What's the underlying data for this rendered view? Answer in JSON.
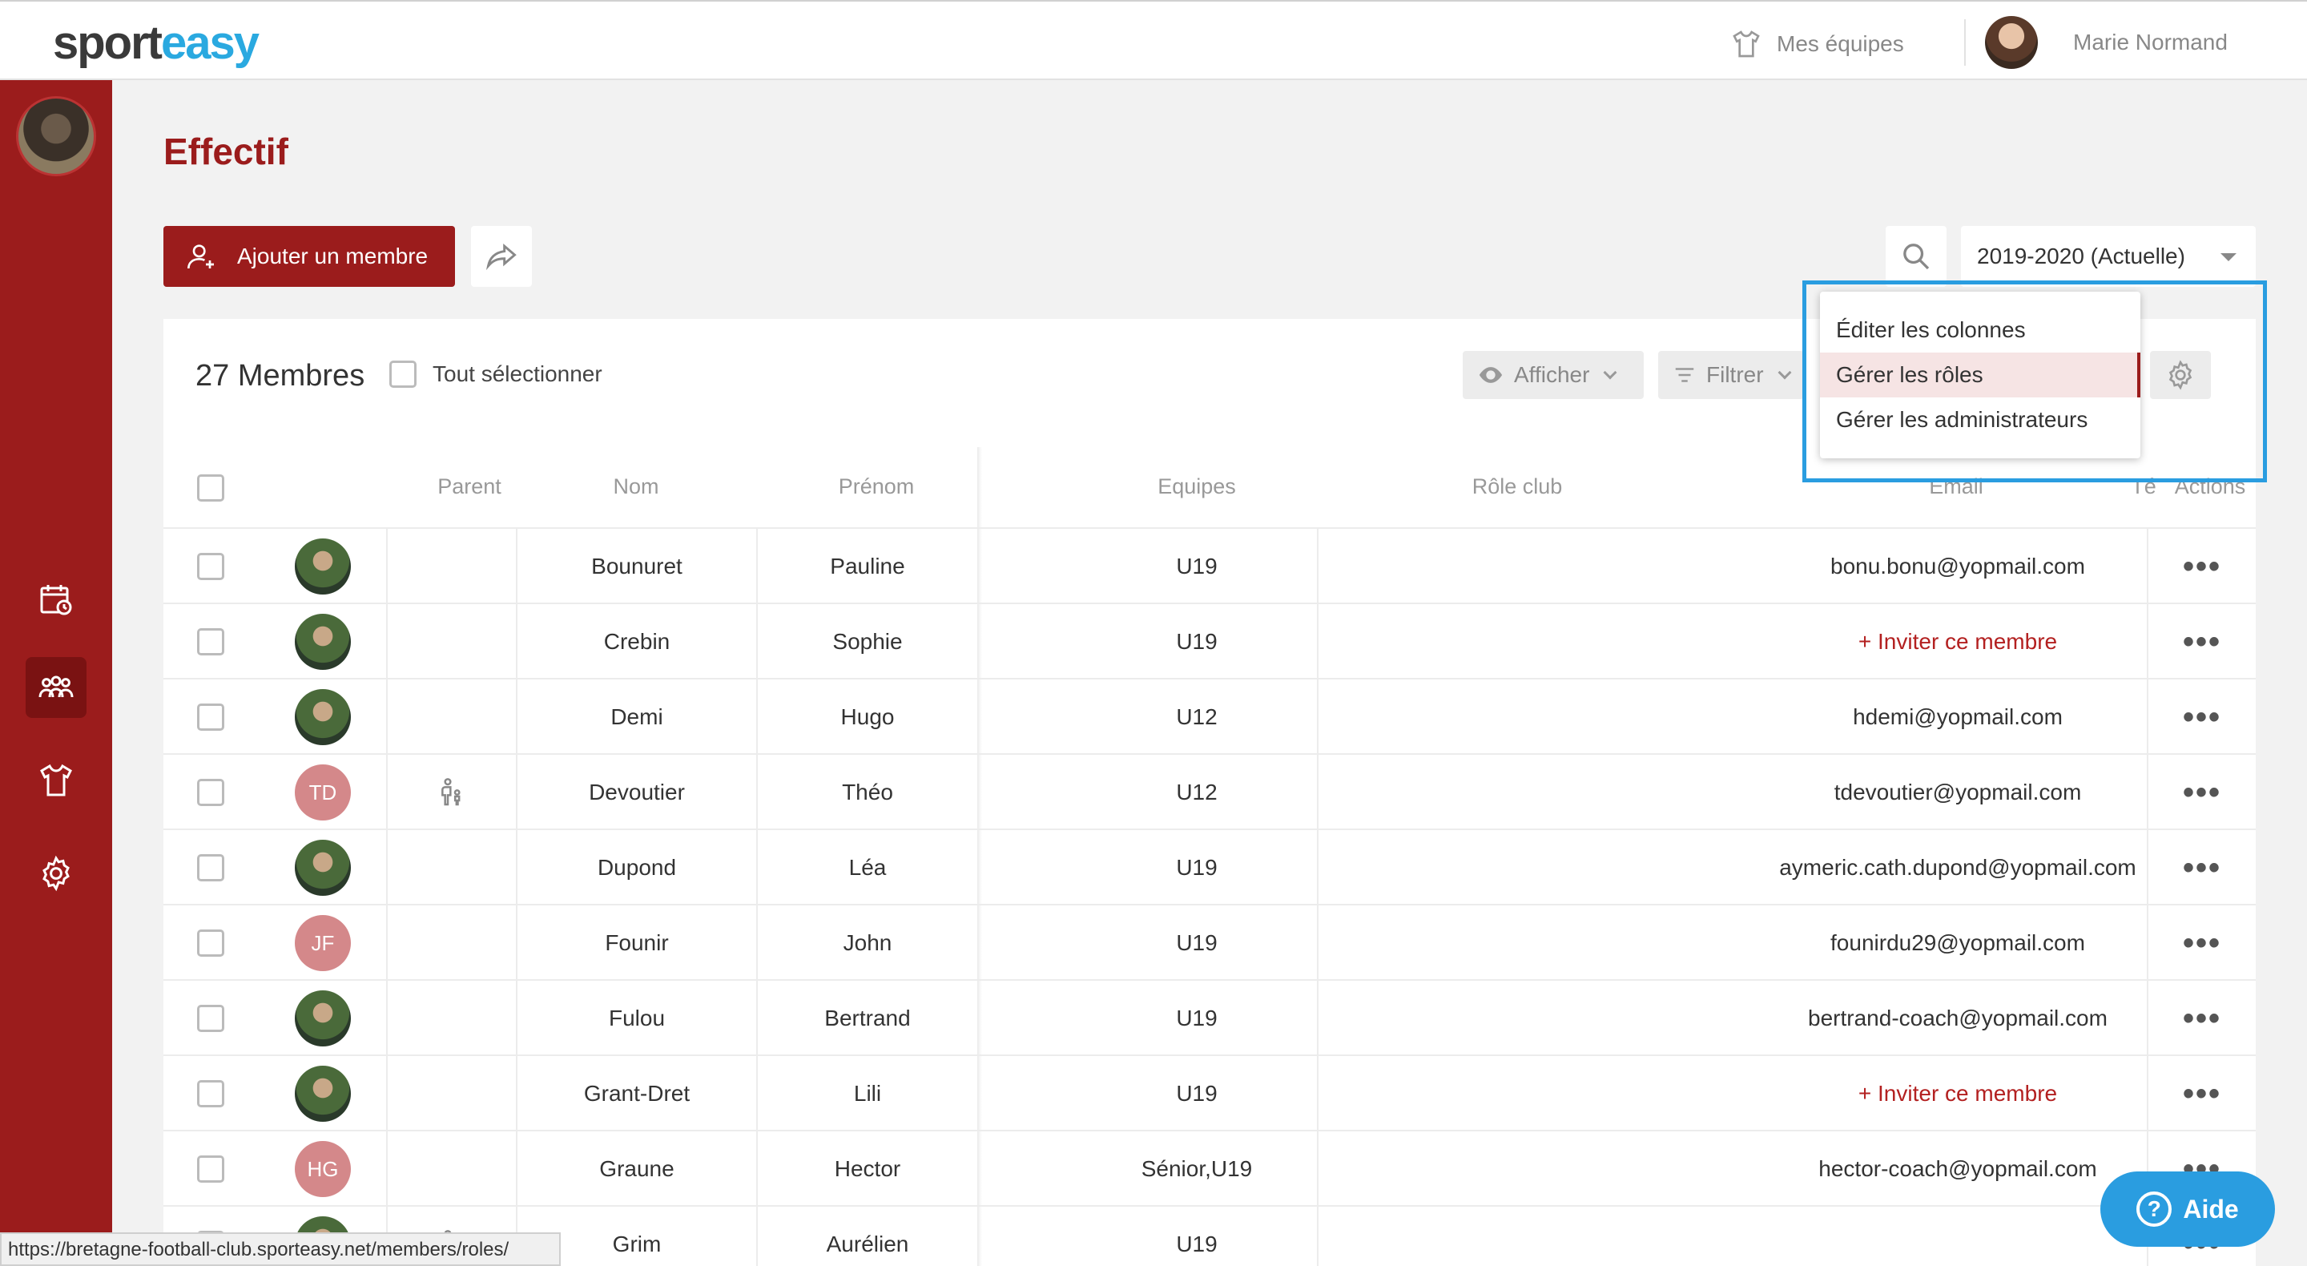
{
  "app": {
    "logo_part1": "sport",
    "logo_part2": "easy",
    "brand_color": "#9b1c1c",
    "accent_color": "#2aa9e0"
  },
  "topbar": {
    "teams_label": "Mes équipes",
    "user_name": "Marie Normand"
  },
  "sidebar": {
    "items": [
      {
        "icon": "calendar-icon",
        "active": false
      },
      {
        "icon": "members-icon",
        "active": true
      },
      {
        "icon": "jersey-icon",
        "active": false
      },
      {
        "icon": "gear-icon",
        "active": false
      }
    ]
  },
  "page": {
    "title": "Effectif",
    "add_member_label": "Ajouter un membre",
    "season_selected": "2019-2020 (Actuelle)"
  },
  "list": {
    "members_count": "27 Membres",
    "select_all_label": "Tout sélectionner",
    "show_label": "Afficher",
    "filter_label": "Filtrer"
  },
  "dropdown": {
    "items": [
      {
        "label": "Éditer les colonnes",
        "hover": false
      },
      {
        "label": "Gérer les rôles",
        "hover": true
      },
      {
        "label": "Gérer les administrateurs",
        "hover": false
      }
    ]
  },
  "table": {
    "headers": {
      "parent": "Parent",
      "nom": "Nom",
      "prenom": "Prénom",
      "equipes": "Equipes",
      "role_club": "Rôle club",
      "email": "Email",
      "tel": "Té",
      "actions": "Actions"
    },
    "rows": [
      {
        "avatar": "photo",
        "initials": "",
        "parent": false,
        "nom": "Bounuret",
        "prenom": "Pauline",
        "equipes": "U19",
        "email": "bonu.bonu@yopmail.com",
        "invite": false
      },
      {
        "avatar": "photo",
        "initials": "",
        "parent": false,
        "nom": "Crebin",
        "prenom": "Sophie",
        "equipes": "U19",
        "email": "+ Inviter ce membre",
        "invite": true
      },
      {
        "avatar": "photo",
        "initials": "",
        "parent": false,
        "nom": "Demi",
        "prenom": "Hugo",
        "equipes": "U12",
        "email": "hdemi@yopmail.com",
        "invite": false
      },
      {
        "avatar": "initials",
        "initials": "TD",
        "parent": true,
        "nom": "Devoutier",
        "prenom": "Théo",
        "equipes": "U12",
        "email": "tdevoutier@yopmail.com",
        "invite": false
      },
      {
        "avatar": "photo",
        "initials": "",
        "parent": false,
        "nom": "Dupond",
        "prenom": "Léa",
        "equipes": "U19",
        "email": "aymeric.cath.dupond@yopmail.com",
        "invite": false
      },
      {
        "avatar": "initials",
        "initials": "JF",
        "parent": false,
        "nom": "Founir",
        "prenom": "John",
        "equipes": "U19",
        "email": "founirdu29@yopmail.com",
        "invite": false
      },
      {
        "avatar": "photo",
        "initials": "",
        "parent": false,
        "nom": "Fulou",
        "prenom": "Bertrand",
        "equipes": "U19",
        "email": "bertrand-coach@yopmail.com",
        "invite": false
      },
      {
        "avatar": "photo",
        "initials": "",
        "parent": false,
        "nom": "Grant-Dret",
        "prenom": "Lili",
        "equipes": "U19",
        "email": "+ Inviter ce membre",
        "invite": true
      },
      {
        "avatar": "initials",
        "initials": "HG",
        "parent": false,
        "nom": "Graune",
        "prenom": "Hector",
        "equipes": "Sénior,U19",
        "email": "hector-coach@yopmail.com",
        "invite": false
      },
      {
        "avatar": "photo",
        "initials": "",
        "parent": true,
        "nom": "Grim",
        "prenom": "Aurélien",
        "equipes": "U19",
        "email": "",
        "invite": false
      }
    ],
    "actions_glyph": "•••"
  },
  "statusbar": {
    "url": "https://bretagne-football-club.sporteasy.net/members/roles/"
  },
  "help": {
    "label": "Aide",
    "icon_glyph": "?"
  }
}
